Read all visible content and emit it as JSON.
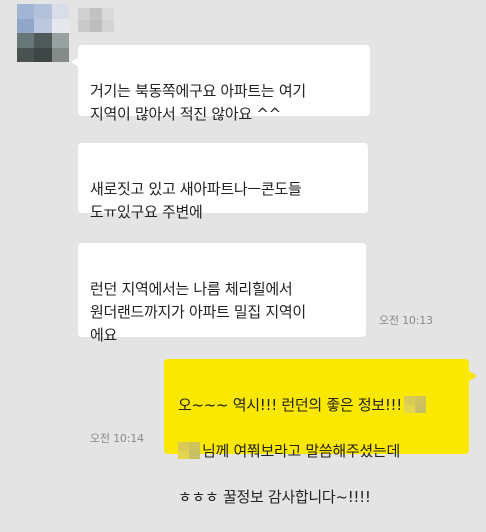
{
  "chat": {
    "avatar_mosaic": [
      "#9cb0d4",
      "#aebfdc",
      "#d7dde9",
      "#8aa0c6",
      "#b8c6e0",
      "#e7e9ee",
      "#5a6b6b",
      "#3f4a4c",
      "#8f9a98",
      "#3a4242",
      "#2d3535",
      "#7b8280"
    ],
    "name_mosaic": [
      "#d0d0d0",
      "#c2c2c2",
      "#dadada",
      "#c9c9c9",
      "#bdbdbd",
      "#d4d4d4"
    ],
    "messages": [
      {
        "text": "거기는 북동쪽에구요 아파트는 여기\n지역이 많아서 적진 않아요 ^^"
      },
      {
        "text": "새로짓고 있고 새아파트나ㅡ콘도들\n도ㅠ있구요 주변에"
      },
      {
        "text": "런던 지역에서는 나름 체리힐에서\n원더랜드까지가 아파트 밀집 지역이\n에요"
      }
    ],
    "time_received": "오전 10:13",
    "my_message": {
      "line1": "오~~~ 역시!!! 런던의 좋은 정보!!!",
      "line2": "님께 여쭤보라고 말씀해주셨는데",
      "line3": "ㅎㅎㅎ 꿀정보 감사합니다~!!!!"
    },
    "time_sent": "오전 10:14"
  }
}
